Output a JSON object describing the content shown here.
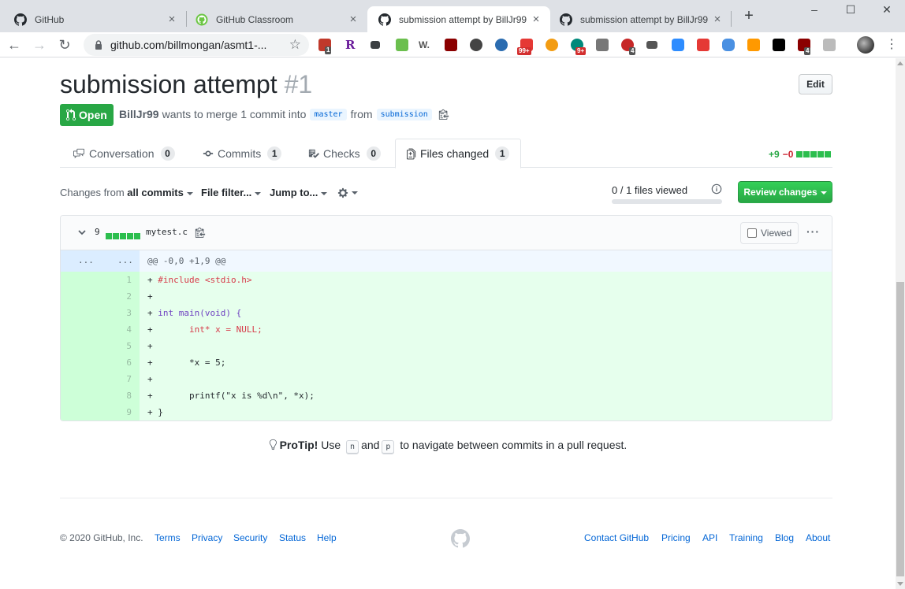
{
  "browser": {
    "tabs": [
      {
        "title": "GitHub",
        "close": "×"
      },
      {
        "title": "GitHub Classroom",
        "close": "×"
      },
      {
        "title": "submission attempt by BillJr99",
        "close": "×"
      },
      {
        "title": "submission attempt by BillJr99",
        "close": "×"
      }
    ],
    "new_tab": "+",
    "url": "github.com/billmongan/asmt1-...",
    "extension_badges": [
      "1",
      "99+",
      "9+",
      "4",
      "4"
    ],
    "window_controls": [
      "–",
      "☐",
      "✕"
    ]
  },
  "pr": {
    "title": "submission attempt",
    "number": "#1",
    "edit_label": "Edit",
    "state": "Open",
    "author": "BillJr99",
    "merge_text": "wants to merge 1 commit into",
    "base_branch": "master",
    "from_text": "from",
    "head_branch": "submission"
  },
  "tabs": [
    {
      "label": "Conversation",
      "count": "0"
    },
    {
      "label": "Commits",
      "count": "1"
    },
    {
      "label": "Checks",
      "count": "0"
    },
    {
      "label": "Files changed",
      "count": "1"
    }
  ],
  "diffstat": {
    "additions": "+9",
    "deletions": "−0"
  },
  "files_toolbar": {
    "changes_from_prefix": "Changes from",
    "changes_from_value": "all commits",
    "file_filter": "File filter...",
    "jump_to": "Jump to...",
    "files_viewed": "0 / 1 files viewed",
    "files_viewed_progress": 0,
    "review_label": "Review changes"
  },
  "file": {
    "line_count": "9",
    "name": "mytest.c",
    "viewed_label": "Viewed",
    "more": "···",
    "hunk_gutter_left": "...",
    "hunk_gutter_right": "...",
    "hunk_header": "@@ -0,0 +1,9 @@",
    "lines": [
      {
        "num": "1",
        "prefix": "+ ",
        "code": "#include <stdio.h>"
      },
      {
        "num": "2",
        "prefix": "+ ",
        "code": ""
      },
      {
        "num": "3",
        "prefix": "+ ",
        "code": "int main(void) {"
      },
      {
        "num": "4",
        "prefix": "+ ",
        "code": "      int* x = NULL;"
      },
      {
        "num": "5",
        "prefix": "+ ",
        "code": ""
      },
      {
        "num": "6",
        "prefix": "+ ",
        "code": "      *x = 5;"
      },
      {
        "num": "7",
        "prefix": "+ ",
        "code": ""
      },
      {
        "num": "8",
        "prefix": "+ ",
        "code": "      printf(\"x is %d\\n\", *x);"
      },
      {
        "num": "9",
        "prefix": "+ ",
        "code": "}"
      }
    ]
  },
  "protip": {
    "label": "ProTip!",
    "use": "Use",
    "key_n": "n",
    "and": "and",
    "key_p": "p",
    "rest": "to navigate between commits in a pull request."
  },
  "footer": {
    "copyright": "© 2020 GitHub, Inc.",
    "left_links": [
      "Terms",
      "Privacy",
      "Security",
      "Status",
      "Help"
    ],
    "right_links": [
      "Contact GitHub",
      "Pricing",
      "API",
      "Training",
      "Blog",
      "About"
    ]
  },
  "colors": {
    "open_green": "#28a745",
    "link_blue": "#0366d6",
    "added_line": "#e6ffed",
    "added_gutter": "#cdffd8"
  }
}
